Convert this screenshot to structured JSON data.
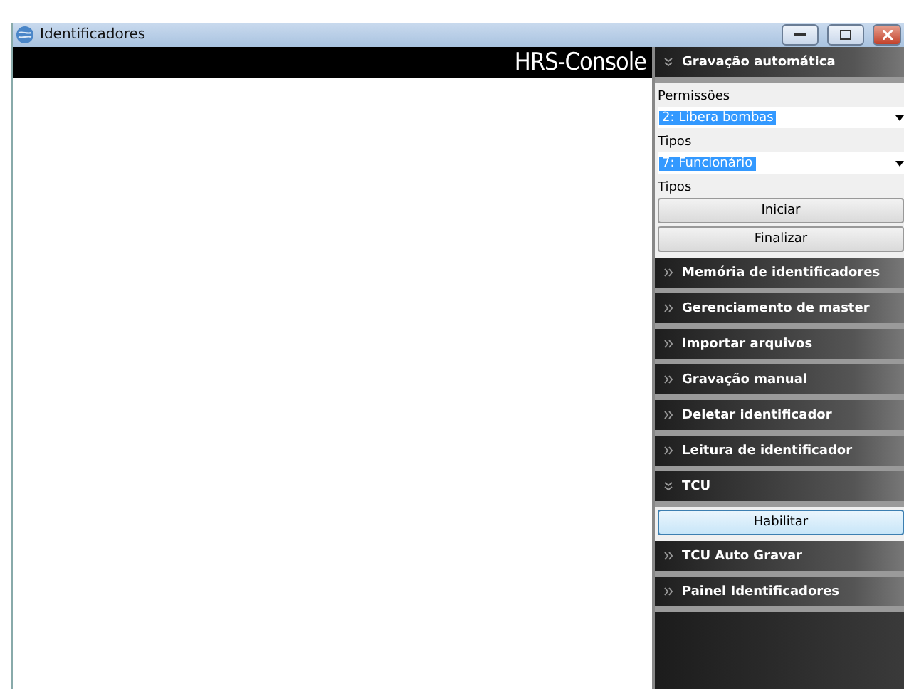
{
  "window": {
    "title": "Identificadores"
  },
  "header": {
    "title": "HRS-Console"
  },
  "sections": [
    {
      "title": "Gravação automática",
      "expanded": true,
      "content": [
        {
          "kind": "label",
          "text": "Permissões"
        },
        {
          "kind": "select",
          "value": "2: Libera bombas"
        },
        {
          "kind": "label",
          "text": "Tipos"
        },
        {
          "kind": "select",
          "value": "7: Funcionário"
        },
        {
          "kind": "label",
          "text": "Tipos"
        },
        {
          "kind": "button",
          "text": "Iniciar",
          "focused": false
        },
        {
          "kind": "button",
          "text": "Finalizar",
          "focused": false
        }
      ]
    },
    {
      "title": "Memória de identificadores",
      "expanded": false
    },
    {
      "title": "Gerenciamento de master",
      "expanded": false
    },
    {
      "title": "Importar arquivos",
      "expanded": false
    },
    {
      "title": "Gravação manual",
      "expanded": false
    },
    {
      "title": "Deletar identificador",
      "expanded": false
    },
    {
      "title": "Leitura de identificador",
      "expanded": false
    },
    {
      "title": "TCU",
      "expanded": true,
      "content": [
        {
          "kind": "button",
          "text": "Habilitar",
          "focused": true
        }
      ]
    },
    {
      "title": "TCU Auto Gravar",
      "expanded": false
    },
    {
      "title": "Painel Identificadores",
      "expanded": false
    }
  ]
}
